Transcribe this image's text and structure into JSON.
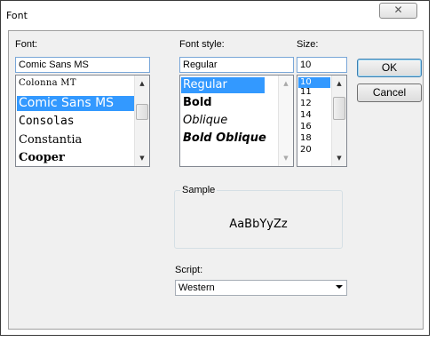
{
  "dialog": {
    "title": "Font",
    "close_glyph": "✕"
  },
  "font": {
    "label": "Font:",
    "value": "Comic Sans MS",
    "items": [
      "Colonna MT",
      "Comic Sans MS",
      "Consolas",
      "Constantia",
      "Cooper"
    ],
    "selected_index": 1
  },
  "style": {
    "label": "Font style:",
    "value": "Regular",
    "items": [
      "Regular",
      "Bold",
      "Oblique",
      "Bold Oblique"
    ],
    "selected_index": 0
  },
  "size": {
    "label": "Size:",
    "value": "10",
    "items": [
      "10",
      "11",
      "12",
      "14",
      "16",
      "18",
      "20"
    ],
    "selected_index": 0
  },
  "buttons": {
    "ok": "OK",
    "cancel": "Cancel"
  },
  "sample": {
    "label": "Sample",
    "text": "AaBbYyZz"
  },
  "script": {
    "label": "Script:",
    "value": "Western"
  },
  "colors": {
    "selection": "#3399ff",
    "face": "#f0f0f0"
  },
  "icons": {
    "scroll_up": "triangle-up-icon",
    "scroll_down": "triangle-down-icon",
    "close": "close-icon"
  }
}
